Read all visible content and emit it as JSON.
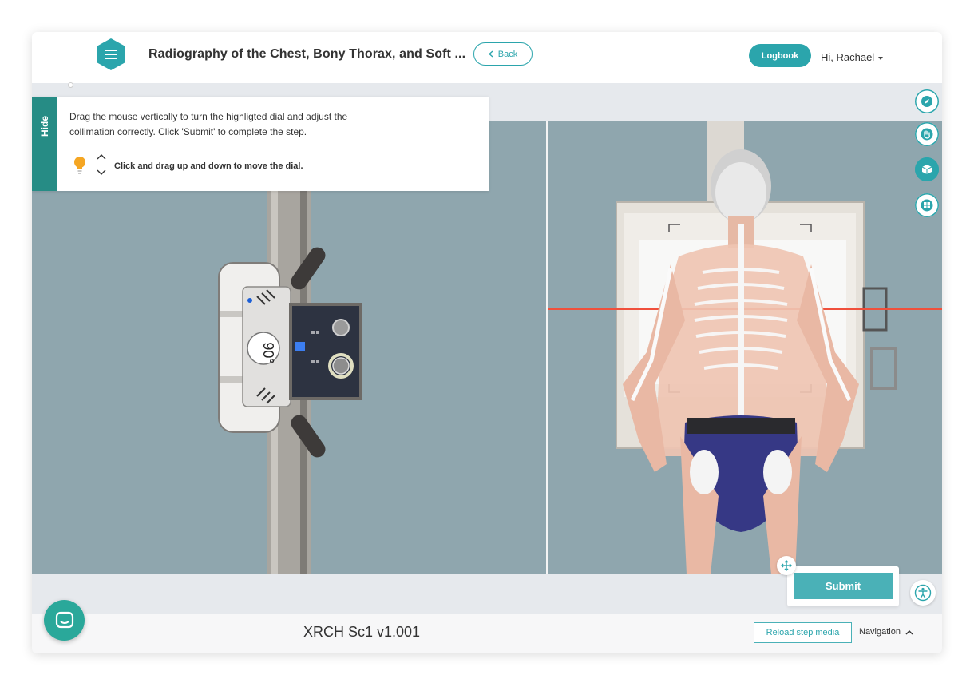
{
  "header": {
    "title": "Radiography of the Chest, Bony Thorax, and Soft ...",
    "back_label": "Back",
    "logbook_label": "Logbook",
    "greeting": "Hi, Rachael"
  },
  "instructions": {
    "hide_label": "Hide",
    "text": "Drag the mouse vertically to turn the highligted dial and adjust the collimation correctly. Click 'Submit' to complete the step.",
    "hint": "Click and drag up and down to move the dial."
  },
  "device": {
    "angle_label": "90°"
  },
  "tools": [
    "compass-icon",
    "hand-icon",
    "cube-icon",
    "grid-icon"
  ],
  "actions": {
    "submit_label": "Submit"
  },
  "footer": {
    "version": "XRCH Sc1 v1.001",
    "reload_label": "Reload step media",
    "navigation_label": "Navigation"
  },
  "colors": {
    "accent": "#2ba5ac",
    "accent_dark": "#268c85",
    "scene_bg": "#8fa6ae"
  }
}
